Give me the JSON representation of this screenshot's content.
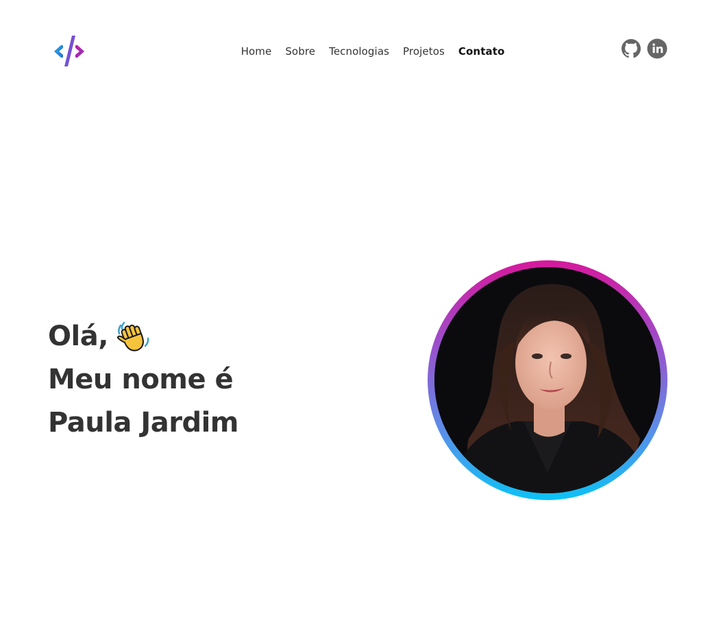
{
  "header": {
    "logo_icon": "code-brackets-icon",
    "nav": [
      {
        "label": "Home",
        "active": false
      },
      {
        "label": "Sobre",
        "active": false
      },
      {
        "label": "Tecnologias",
        "active": false
      },
      {
        "label": "Projetos",
        "active": false
      },
      {
        "label": "Contato",
        "active": true
      }
    ],
    "socials": [
      {
        "icon": "github-icon"
      },
      {
        "icon": "linkedin-icon"
      }
    ]
  },
  "hero": {
    "line1": "Olá,",
    "wave_icon": "waving-hand-icon",
    "line2": "Meu nome é",
    "line3": "Paula Jardim",
    "photo_icon": "profile-photo"
  },
  "colors": {
    "text": "#333333",
    "ring_top": "#d6189c",
    "ring_bottom": "#0cc2f5",
    "social_icon": "#666666"
  }
}
